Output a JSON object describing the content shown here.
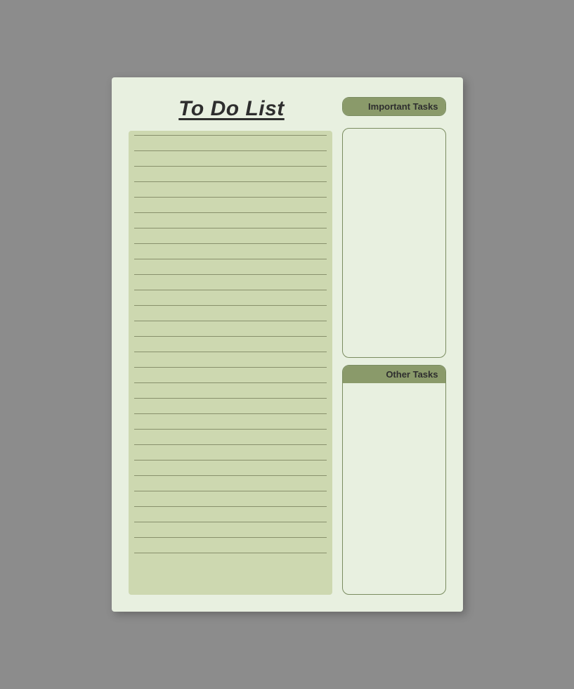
{
  "page": {
    "title": "To Do List",
    "background_color": "#e8f0e0",
    "outer_background": "#8c8c8c"
  },
  "important_tasks": {
    "label": "Important Tasks"
  },
  "other_tasks": {
    "label": "Other Tasks"
  },
  "lines": {
    "count": 28
  }
}
